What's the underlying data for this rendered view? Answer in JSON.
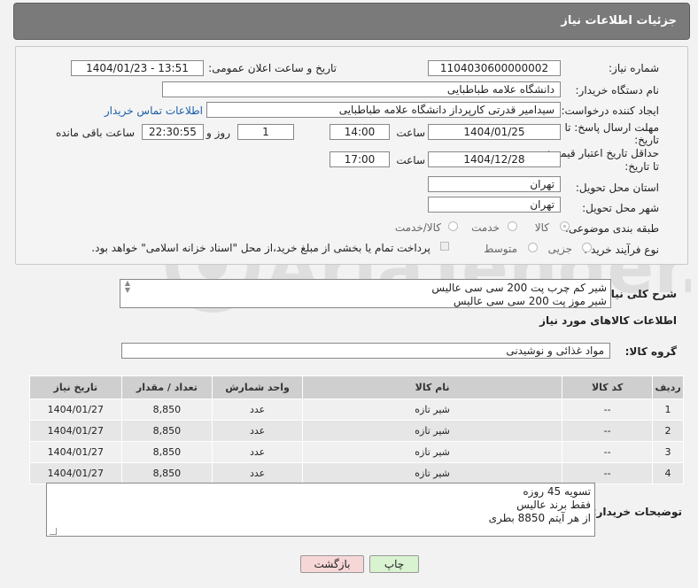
{
  "header": {
    "title": "جزئیات اطلاعات نیاز"
  },
  "form": {
    "need_number_label": "شماره نیاز:",
    "need_number": "1104030600000002",
    "announce_label": "تاریخ و ساعت اعلان عمومی:",
    "announce_value": "1404/01/23 - 13:51",
    "buyer_org_label": "نام دستگاه خریدار:",
    "buyer_org": "دانشگاه علامه طباطبایی",
    "creator_label": "ایجاد کننده درخواست:",
    "creator": "سیدامیر قدرتی کارپرداز دانشگاه علامه طباطبایی",
    "contact_link": "اطلاعات تماس خریدار",
    "deadline_label_1": "مهلت ارسال پاسخ: تا",
    "deadline_label_2": "تاریخ:",
    "deadline_date": "1404/01/25",
    "time_word": "ساعت",
    "deadline_time": "14:00",
    "days_value": "1",
    "days_word": "روز و",
    "remaining_value": "22:30:55",
    "remaining_word": "ساعت باقی مانده",
    "validity_label_1": "حداقل تاریخ اعتبار قیمت:",
    "validity_label_2": "تا تاریخ:",
    "validity_date": "1404/12/28",
    "validity_time_word": "ساعت",
    "validity_time": "17:00",
    "province_label": "استان محل تحویل:",
    "province": "تهران",
    "city_label": "شهر محل تحویل:",
    "city": "تهران",
    "category_label": "طبقه بندی موضوعی:",
    "category_options": [
      "کالا",
      "خدمت",
      "کالا/خدمت"
    ],
    "category_selected": "کالا",
    "process_label": "نوع فرآیند خرید :",
    "process_options": [
      "جزیی",
      "متوسط"
    ],
    "process_note": "پرداخت تمام یا بخشی از مبلغ خرید،از محل \"اسناد خزانه اسلامی\" خواهد بود."
  },
  "description": {
    "label": "شرح کلی نیاز:",
    "lines": [
      "شیر کم چرب پت 200 سی سی عالیس",
      "شیر موز پت 200 سی سی عالیس"
    ]
  },
  "goods_section": {
    "title": "اطلاعات کالاهای مورد نیاز",
    "group_label": "گروه کالا:",
    "group_value": "مواد غذائی و نوشیدنی"
  },
  "table": {
    "columns": [
      "ردیف",
      "کد کالا",
      "نام کالا",
      "واحد شمارش",
      "تعداد / مقدار",
      "تاریخ نیاز"
    ],
    "rows": [
      [
        "1",
        "--",
        "شیر تازه",
        "عدد",
        "8,850",
        "1404/01/27"
      ],
      [
        "2",
        "--",
        "شیر تازه",
        "عدد",
        "8,850",
        "1404/01/27"
      ],
      [
        "3",
        "--",
        "شیر تازه",
        "عدد",
        "8,850",
        "1404/01/27"
      ],
      [
        "4",
        "--",
        "شیر تازه",
        "عدد",
        "8,850",
        "1404/01/27"
      ]
    ]
  },
  "buyer_notes": {
    "label": "توضیحات خریدار:",
    "lines": [
      "تسویه 45 روزه",
      "فقط برند عالیس",
      "از هر آیتم 8850 بطری"
    ]
  },
  "buttons": {
    "print": "چاپ",
    "back": "بازگشت"
  },
  "watermark": {
    "text": "AriaTender.neT"
  },
  "colors": {
    "header_bg": "#7a7a7a",
    "link": "#1a5ea8",
    "back_button_bg": "#f6d6d6",
    "print_button_bg": "#d9f2d0"
  }
}
